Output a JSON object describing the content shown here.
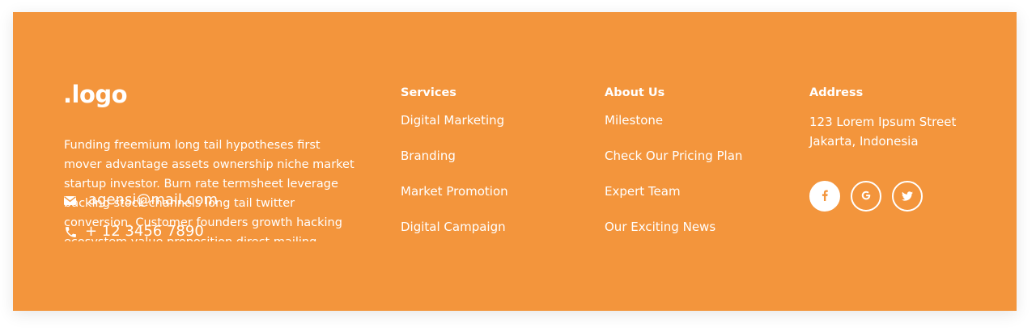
{
  "brand": {
    "logo_text": ".logo",
    "description": "Funding freemium long tail hypotheses first mover advantage assets ownership niche market startup investor. Burn rate termsheet leverage backing stock channels long tail twitter conversion. Customer founders growth hacking ecosystem value proposition direct mailing."
  },
  "contact": {
    "email": "agensi@mail.com",
    "phone": "+ 12 3456 7890",
    "email_icon": "envelope-icon",
    "phone_icon": "phone-icon"
  },
  "services": {
    "heading": "Services",
    "links": [
      "Digital Marketing",
      "Branding",
      "Market Promotion",
      "Digital Campaign"
    ]
  },
  "about": {
    "heading": "About Us",
    "links": [
      "Milestone",
      "Check Our Pricing Plan",
      "Expert Team",
      "Our Exciting News"
    ]
  },
  "address": {
    "heading": "Address",
    "line1": "123 Lorem Ipsum Street",
    "line2": "Jakarta, Indonesia"
  },
  "social": [
    {
      "name": "facebook-icon",
      "glyph": "f",
      "active": true
    },
    {
      "name": "google-icon",
      "glyph": "G",
      "active": false
    },
    {
      "name": "twitter-icon",
      "glyph": "bird",
      "active": false
    }
  ],
  "colors": {
    "footer_bg": "#f3953c",
    "text": "#ffffff",
    "accent": "#f3953c"
  }
}
